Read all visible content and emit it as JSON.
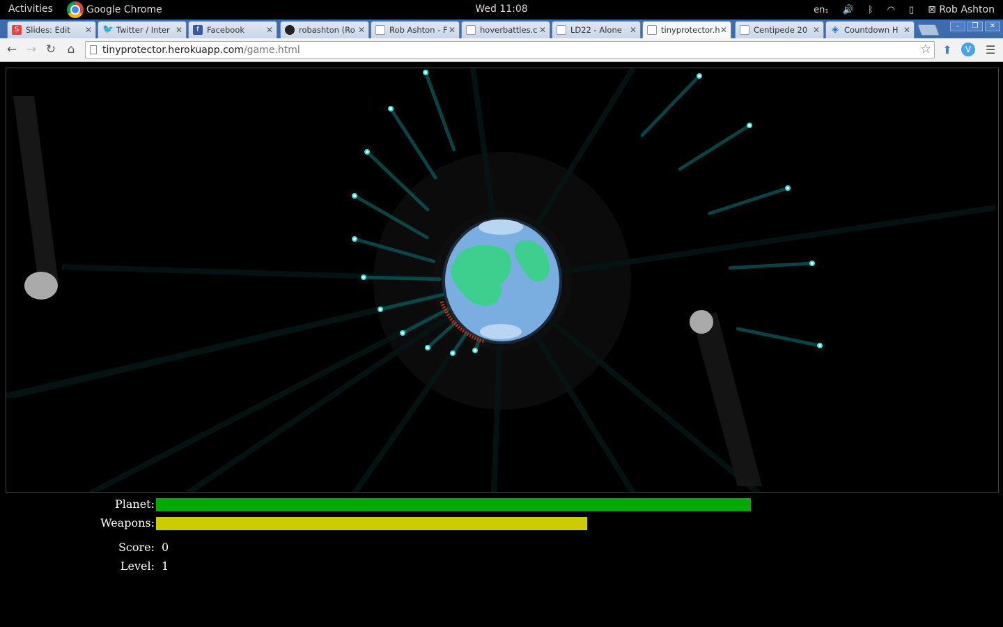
{
  "desktop": {
    "activities": "Activities",
    "app_name": "Google Chrome",
    "clock": "Wed 11:08",
    "keyboard": "en₁",
    "user": "Rob Ashton"
  },
  "tabs": [
    {
      "title": "Slides: Edit",
      "icon": "slides-icon"
    },
    {
      "title": "Twitter / Inter",
      "icon": "twitter-icon"
    },
    {
      "title": "Facebook",
      "icon": "facebook-icon"
    },
    {
      "title": "robashton (Ro",
      "icon": "github-icon"
    },
    {
      "title": "Rob Ashton - F",
      "icon": "document-icon"
    },
    {
      "title": "hoverbattles.c",
      "icon": "document-icon"
    },
    {
      "title": "LD22 - Alone",
      "icon": "document-icon"
    },
    {
      "title": "tinyprotector.h",
      "icon": "document-icon",
      "active": true
    },
    {
      "title": "Centipede 20",
      "icon": "document-icon"
    },
    {
      "title": "Countdown H",
      "icon": "countdown-icon"
    }
  ],
  "address_bar": {
    "host": "tinyprotector.herokuapp.com",
    "path": "/game.html"
  },
  "hud": {
    "planet_label": "Planet:",
    "planet_health": 0.8,
    "planet_color": "#00aa00",
    "weapons_label": "Weapons:",
    "weapons_level": 0.58,
    "weapons_color": "#cccc00",
    "score_label": "Score:",
    "score": "0",
    "level_label": "Level:",
    "level": "1"
  },
  "game_colors": {
    "space": "#000000",
    "ocean": "#7aaee0",
    "land": "#3ccf8e",
    "cloud": "#b8d6f2",
    "projectile": "#2fe0e0",
    "asteroid": "#aaaaaa"
  }
}
